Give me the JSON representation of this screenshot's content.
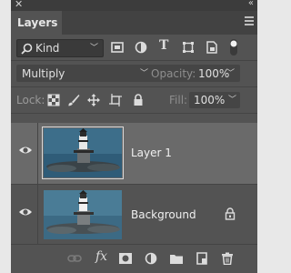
{
  "panel": {
    "tab_label": "Layers"
  },
  "filter": {
    "kind_label": "Kind",
    "icons": [
      "image-filter-icon",
      "adjustment-filter-icon",
      "type-filter-icon",
      "shape-filter-icon",
      "smart-object-filter-icon",
      "filter-toggle-icon"
    ]
  },
  "blend": {
    "mode": "Multiply",
    "opacity_label": "Opacity:",
    "opacity_value": "100%"
  },
  "lock": {
    "label": "Lock:",
    "fill_label": "Fill:",
    "fill_value": "100%",
    "icons": [
      "lock-transparent-pixels-icon",
      "lock-image-pixels-icon",
      "lock-position-icon",
      "lock-artboard-icon",
      "lock-all-icon"
    ]
  },
  "layers": [
    {
      "name": "Layer 1",
      "selected": true,
      "visible": true,
      "locked": false
    },
    {
      "name": "Background",
      "selected": false,
      "visible": true,
      "locked": true
    }
  ],
  "footer": {
    "fx_label": "fx",
    "icons": [
      "link-layers-icon",
      "fx-icon",
      "add-mask-icon",
      "new-fill-adjustment-icon",
      "new-group-icon",
      "new-layer-icon",
      "delete-layer-icon"
    ]
  },
  "colors": {
    "panel_bg": "#535353",
    "selected_row": "#6a6a6a",
    "input_bg": "#454545"
  }
}
